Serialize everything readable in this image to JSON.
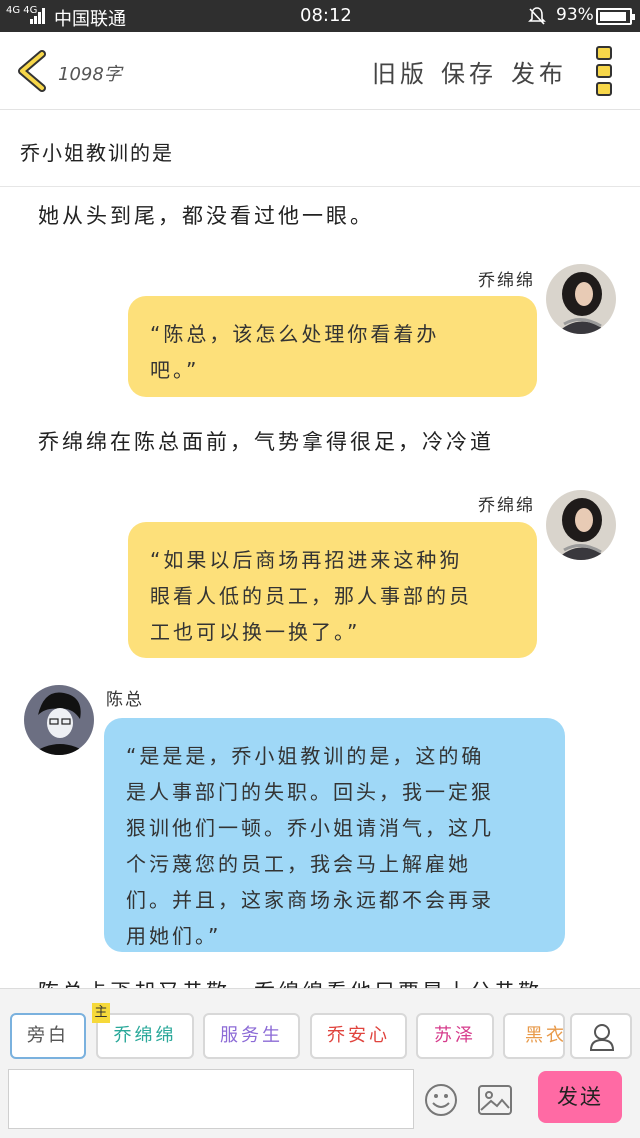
{
  "status_bar": {
    "network": "4G 4G",
    "carrier": "中国联通",
    "time": "08:12",
    "battery": "93%",
    "battery_level": 0.93
  },
  "toolbar": {
    "word_count": "1098字",
    "old_version": "旧版",
    "save": "保存",
    "publish": "发布",
    "accent_color": "#f7d74a"
  },
  "chapter_title": "乔小姐教训的是",
  "messages": [
    {
      "type": "narration",
      "text": "她从头到尾，都没看过他一眼。"
    },
    {
      "type": "speech",
      "speaker": "乔绵绵",
      "side": "right",
      "color": "#fde07a",
      "lines": [
        "“陈总，该怎么处理你看着办",
        "吧。”"
      ]
    },
    {
      "type": "narration",
      "text": "乔绵绵在陈总面前，气势拿得很足，冷冷道"
    },
    {
      "type": "speech",
      "speaker": "乔绵绵",
      "side": "right",
      "color": "#fde07a",
      "lines": [
        "“如果以后商场再招进来这种狗",
        "眼看人低的员工，那人事部的员",
        "工也可以换一换了。”"
      ]
    },
    {
      "type": "speech",
      "speaker": "陈总",
      "side": "left",
      "color": "#9fd8f7",
      "lines": [
        "“是是是，乔小姐教训的是，这的确",
        "是人事部门的失职。回头，我一定狠",
        "狠训他们一顿。乔小姐请消气，这几",
        "个污蔑您的员工，我会马上解雇她",
        "们。并且，这家商场永远都不会再录",
        "用她们。”"
      ]
    },
    {
      "type": "narration",
      "text": "陈总忐忑却又恭敬，乔绵绵看他只要是十分恭敬"
    }
  ],
  "characters": [
    {
      "label": "旁白",
      "color": "#555555",
      "active": true
    },
    {
      "label": "乔绵绵",
      "color": "#2aa89a",
      "badge": "主"
    },
    {
      "label": "服务生",
      "color": "#8c6bd6"
    },
    {
      "label": "乔安心",
      "color": "#e0443e"
    },
    {
      "label": "苏泽",
      "color": "#d63c8c"
    },
    {
      "label": "黑衣人",
      "color": "#e89a4a"
    }
  ],
  "composer": {
    "placeholder": "",
    "send_label": "发送",
    "send_color": "#ff6aa4"
  },
  "icons": [
    "back-chevron-icon",
    "more-menu-icon",
    "user-icon",
    "emoji-icon",
    "image-icon",
    "mute-bell-icon",
    "battery-icon",
    "signal-icon"
  ]
}
